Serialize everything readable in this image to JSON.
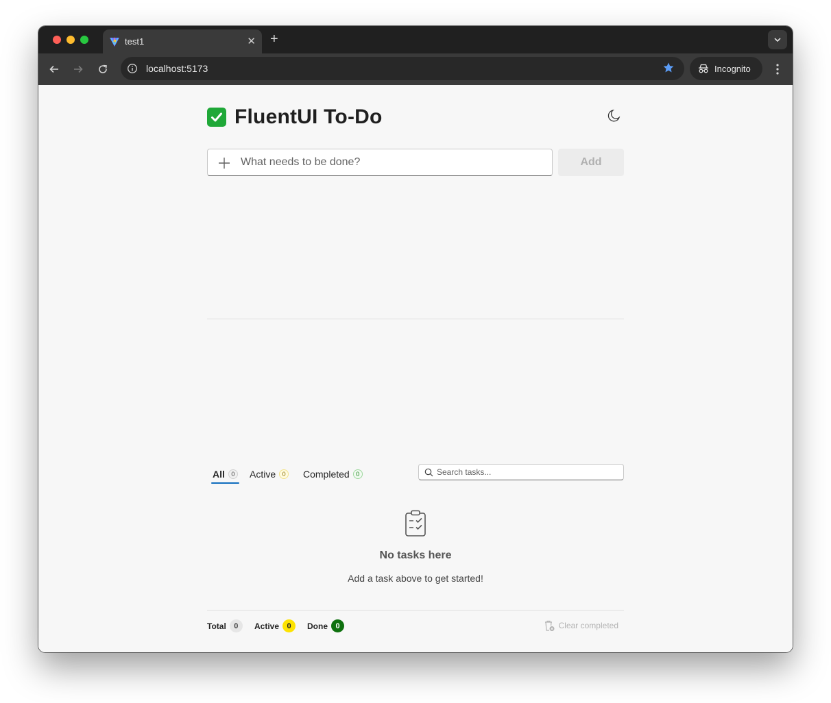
{
  "browser": {
    "tab_title": "test1",
    "url": "localhost:5173",
    "incognito_label": "Incognito"
  },
  "app": {
    "title": "FluentUI To-Do",
    "title_emoji": "check-mark-button-icon",
    "new_task_placeholder": "What needs to be done?",
    "add_label": "Add",
    "filters": [
      {
        "label": "All",
        "count": "0"
      },
      {
        "label": "Active",
        "count": "0"
      },
      {
        "label": "Completed",
        "count": "0"
      }
    ],
    "search_placeholder": "Search tasks...",
    "empty_title": "No tasks here",
    "empty_subtitle": "Add a task above to get started!",
    "stats": [
      {
        "label": "Total",
        "count": "0"
      },
      {
        "label": "Active",
        "count": "0"
      },
      {
        "label": "Done",
        "count": "0"
      }
    ],
    "clear_completed_label": "Clear completed"
  },
  "colors": {
    "accent": "#0f6cbd",
    "done_badge": "#0e700e",
    "active_badge": "#fde300",
    "title_emoji_bg": "#1fa838"
  }
}
